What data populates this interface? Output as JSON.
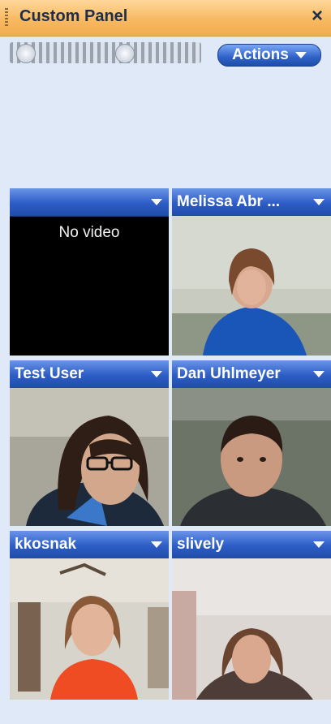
{
  "window": {
    "title": "Custom Panel",
    "close_glyph": "×"
  },
  "toolbar": {
    "actions_label": "Actions"
  },
  "tiles": [
    {
      "name": "",
      "status": "No video"
    },
    {
      "name": "Melissa Abr ..."
    },
    {
      "name": "Test User"
    },
    {
      "name": "Dan Uhlmeyer"
    },
    {
      "name": "kkosnak"
    },
    {
      "name": "slively"
    }
  ],
  "colors": {
    "titlebar": "#f5b65a",
    "header_blue": "#2c5cc6",
    "panel_bg": "#dfe9f8"
  }
}
